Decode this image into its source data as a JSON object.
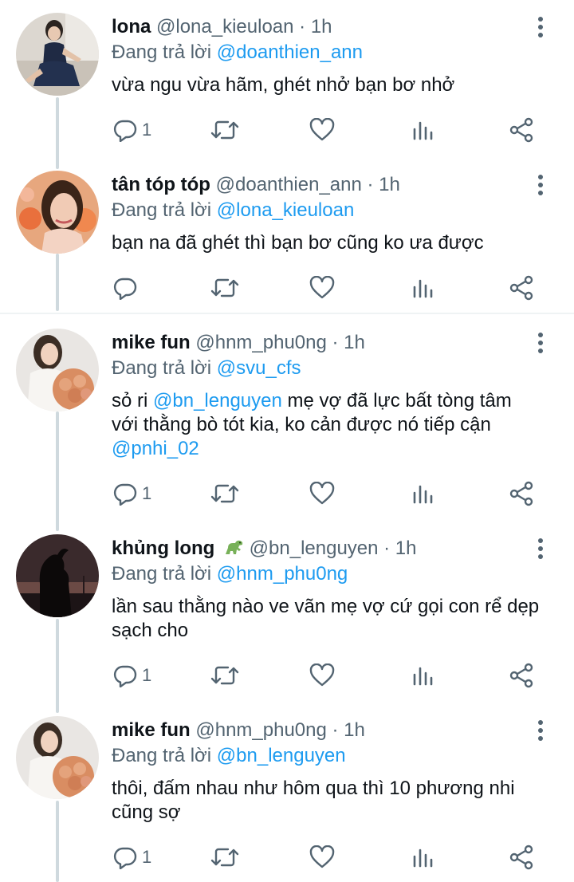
{
  "reply_prefix": "Đang trả lời",
  "tweets": [
    {
      "name": "lona",
      "emoji": "",
      "handle": "@lona_kieuloan · 1h",
      "reply_to": "@doanthien_ann",
      "lines": [
        {
          "text": "vừa ngu vừa hãm, ghét nhở bạn bơ nhở",
          "mention_lead": "",
          "tail": ""
        }
      ],
      "reply_count": "1"
    },
    {
      "name": "tân tóp tóp",
      "emoji": "",
      "handle": "@doanthien_ann · 1h",
      "reply_to": "@lona_kieuloan",
      "lines": [
        {
          "text": "bạn na đã ghét thì bạn bơ cũng ko ưa được",
          "mention_lead": "",
          "tail": ""
        }
      ],
      "reply_count": ""
    },
    {
      "name": "mike fun",
      "emoji": "",
      "handle": "@hnm_phu0ng · 1h",
      "reply_to": "@svu_cfs",
      "lines": [
        {
          "text": "sỏ ri ",
          "mention_lead": "@bn_lenguyen",
          "tail": " mẹ vợ đã lực bất tòng tâm"
        },
        {
          "text": "với thằng bò tót kia, ko cản được nó tiếp cận",
          "mention_lead": "",
          "tail": ""
        },
        {
          "text": "",
          "mention_lead": "@pnhi_02",
          "tail": ""
        }
      ],
      "reply_count": "1"
    },
    {
      "name": "khủng long",
      "emoji": "🦖",
      "handle": "@bn_lenguyen · 1h",
      "reply_to": "@hnm_phu0ng",
      "lines": [
        {
          "text": "lần sau thằng nào ve vãn mẹ vợ cứ gọi con rể dẹp",
          "mention_lead": "",
          "tail": ""
        },
        {
          "text": "sạch cho",
          "mention_lead": "",
          "tail": ""
        }
      ],
      "reply_count": "1"
    },
    {
      "name": "mike fun",
      "emoji": "",
      "handle": "@hnm_phu0ng · 1h",
      "reply_to": "@bn_lenguyen",
      "lines": [
        {
          "text": "thôi, đấm nhau như hôm qua thì 10 phương nhi",
          "mention_lead": "",
          "tail": ""
        },
        {
          "text": "cũng sợ",
          "mention_lead": "",
          "tail": ""
        }
      ],
      "reply_count": "1"
    }
  ],
  "icons": {
    "more": "more-vertical-icon",
    "reply": "reply-bubble-icon",
    "retweet": "retweet-icon",
    "like": "heart-icon",
    "views": "analytics-bars-icon",
    "share": "share-icon"
  },
  "colors": {
    "text": "#0f1419",
    "secondary": "#536471",
    "mention": "#1d9bf0",
    "thread_line": "#cfd9de"
  }
}
